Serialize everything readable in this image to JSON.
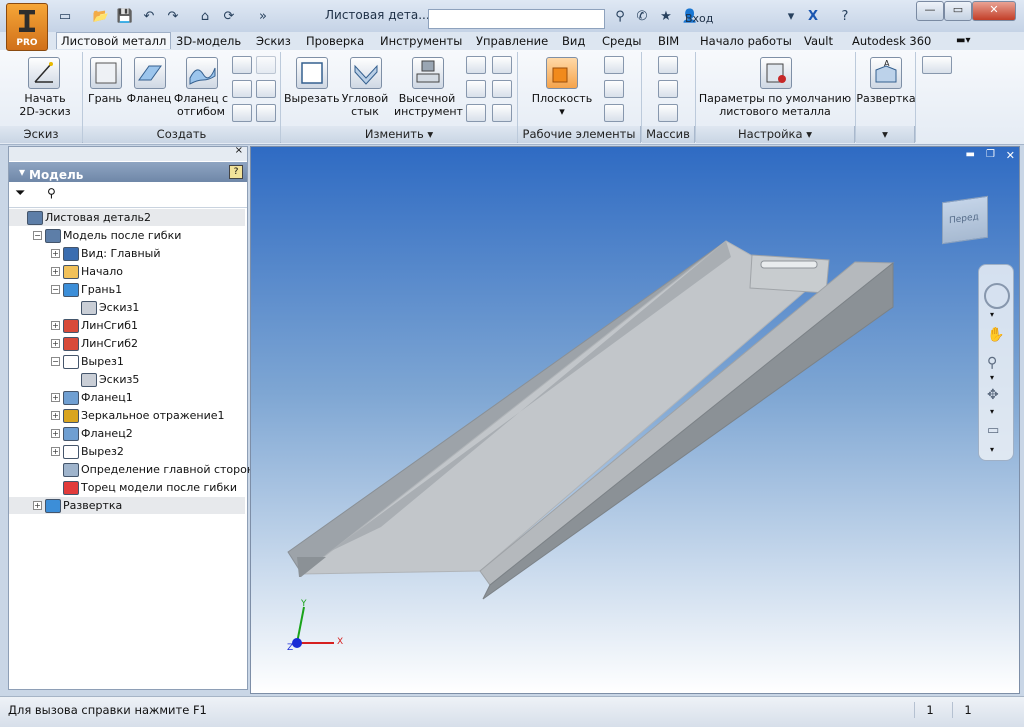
{
  "window": {
    "title": "Листовая дета...",
    "login": "Вход",
    "app_badge": "PRO"
  },
  "tabs": [
    "Листовой металл",
    "3D-модель",
    "Эскиз",
    "Проверка",
    "Инструменты",
    "Управление",
    "Вид",
    "Среды",
    "BIM",
    "Начало работы",
    "Vault",
    "Autodesk 360"
  ],
  "ribbon": {
    "sketch": {
      "start_line1": "Начать",
      "start_line2": "2D-эскиз",
      "panel": "Эскиз"
    },
    "create": {
      "face": "Грань",
      "flange": "Фланец",
      "contour1": "Фланец с",
      "contour2": "отгибом",
      "panel": "Создать"
    },
    "modify": {
      "cut": "Вырезать",
      "corner1": "Угловой",
      "corner2": "стык",
      "punch1": "Высечной",
      "punch2": "инструмент",
      "panel": "Изменить"
    },
    "work": {
      "plane": "Плоскость",
      "panel": "Рабочие элементы"
    },
    "pattern": {
      "panel": "Массив"
    },
    "setup": {
      "defaults1": "Параметры по умолчанию",
      "defaults2": "листового металла",
      "panel": "Настройка"
    },
    "flat": {
      "label": "Развертка"
    }
  },
  "browser": {
    "header": "Модель",
    "tree": [
      {
        "label": "Листовая деталь2",
        "level": 0,
        "expander": "",
        "icon": "part",
        "selected": true
      },
      {
        "label": "Модель после гибки",
        "level": 1,
        "expander": "−",
        "icon": "folded",
        "selected": false
      },
      {
        "label": "Вид: Главный",
        "level": 2,
        "expander": "+",
        "icon": "view",
        "selected": false
      },
      {
        "label": "Начало",
        "level": 2,
        "expander": "+",
        "icon": "folder",
        "selected": false
      },
      {
        "label": "Грань1",
        "level": 2,
        "expander": "−",
        "icon": "face",
        "selected": false
      },
      {
        "label": "Эскиз1",
        "level": 3,
        "expander": "",
        "icon": "sketch",
        "selected": false
      },
      {
        "label": "ЛинСгиб1",
        "level": 2,
        "expander": "+",
        "icon": "bend",
        "selected": false
      },
      {
        "label": "ЛинСгиб2",
        "level": 2,
        "expander": "+",
        "icon": "bend",
        "selected": false
      },
      {
        "label": "Вырез1",
        "level": 2,
        "expander": "−",
        "icon": "cut",
        "selected": false
      },
      {
        "label": "Эскиз5",
        "level": 3,
        "expander": "",
        "icon": "sketch",
        "selected": false
      },
      {
        "label": "Фланец1",
        "level": 2,
        "expander": "+",
        "icon": "flange",
        "selected": false
      },
      {
        "label": "Зеркальное отражение1",
        "level": 2,
        "expander": "+",
        "icon": "mirror",
        "selected": false
      },
      {
        "label": "Фланец2",
        "level": 2,
        "expander": "+",
        "icon": "flange",
        "selected": false
      },
      {
        "label": "Вырез2",
        "level": 2,
        "expander": "+",
        "icon": "cut",
        "selected": false
      },
      {
        "label": "Определение главной стороны",
        "level": 2,
        "expander": "",
        "icon": "aside",
        "selected": false
      },
      {
        "label": "Торец модели после гибки",
        "level": 2,
        "expander": "",
        "icon": "end",
        "selected": false
      },
      {
        "label": "Развертка",
        "level": 1,
        "expander": "+",
        "icon": "flat",
        "selected": true
      }
    ]
  },
  "viewcube": {
    "face_label": "Перед"
  },
  "triad": {
    "x": "X",
    "y": "Y",
    "z": "Z"
  },
  "status": {
    "message": "Для вызова справки нажмите F1",
    "count1": "1",
    "count2": "1"
  }
}
